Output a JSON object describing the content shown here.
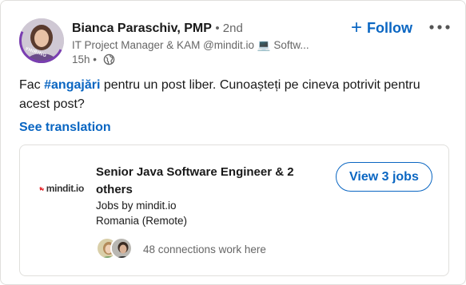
{
  "author": {
    "name": "Bianca Paraschiv, PMP",
    "degree": "• 2nd",
    "headline": "IT Project Manager & KAM @mindit.io 💻 Softw...",
    "time": "15h •",
    "badge": "#HIRING"
  },
  "actions": {
    "follow_label": "Follow",
    "follow_plus": "+"
  },
  "post": {
    "text_before": "Fac ",
    "hashtag": "#angajări",
    "text_after": " pentru un post liber. Cunoașteți pe cineva potrivit pentru acest post?",
    "see_translation": "See translation"
  },
  "job": {
    "logo_text": "mindit.io",
    "title": "Senior Java Software Engineer & 2 others",
    "company_line": "Jobs by mindit.io",
    "location": "Romania (Remote)",
    "view_button": "View 3 jobs",
    "connections_text": "48 connections work here"
  },
  "colors": {
    "link": "#0a66c2",
    "muted": "#666666",
    "logo_red": "#e4262b"
  },
  "icons": [
    "globe-icon",
    "more-icon",
    "plus-icon"
  ]
}
